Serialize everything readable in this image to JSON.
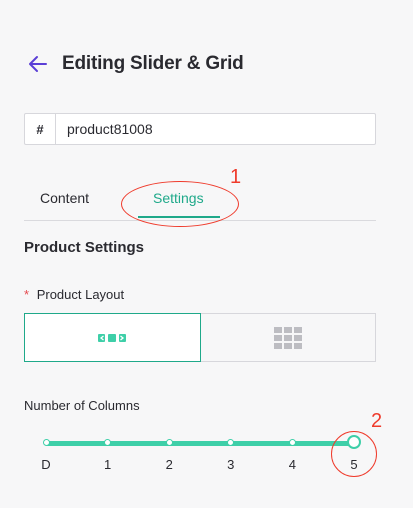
{
  "header": {
    "title": "Editing Slider & Grid",
    "back_icon": "arrow-left-icon",
    "back_icon_color": "#5b3fd6"
  },
  "id_field": {
    "prefix": "#",
    "value": "product81008"
  },
  "tabs": [
    {
      "label": "Content",
      "active": false
    },
    {
      "label": "Settings",
      "active": true
    }
  ],
  "section": {
    "heading": "Product Settings"
  },
  "layout": {
    "required_marker": "*",
    "label": "Product Layout",
    "options": [
      {
        "icon": "slider-carousel-icon",
        "selected": true
      },
      {
        "icon": "grid-icon",
        "selected": false
      }
    ]
  },
  "columns": {
    "label": "Number of Columns",
    "ticks": [
      "D",
      "1",
      "2",
      "3",
      "4",
      "5"
    ],
    "selected": "5"
  },
  "annotations": {
    "first": "1",
    "second": "2",
    "color": "#ef3b2c"
  },
  "colors": {
    "accent": "#1fa98a",
    "slider": "#3ecfa8",
    "background": "#f7f7f8"
  }
}
